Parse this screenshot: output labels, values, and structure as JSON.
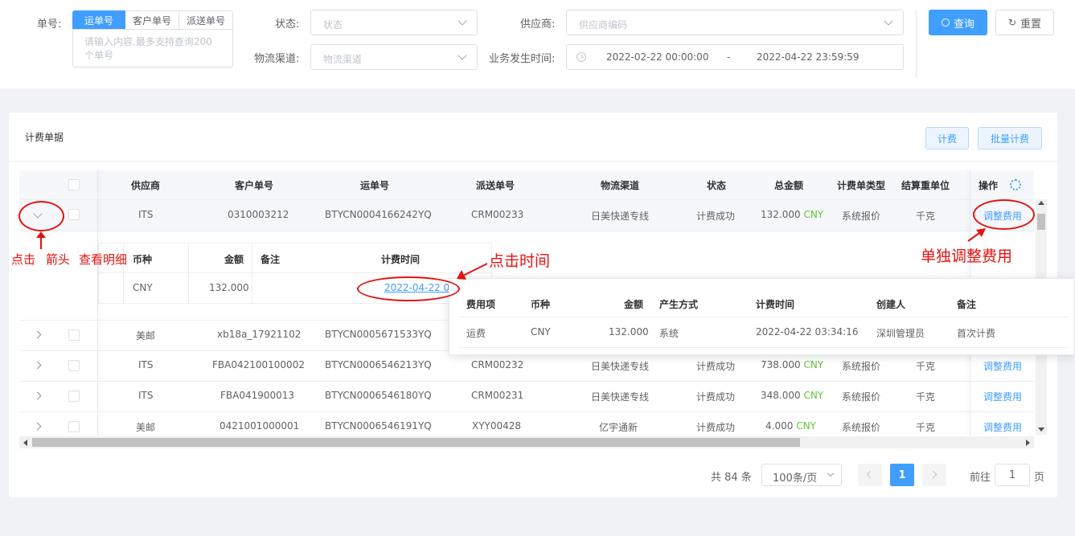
{
  "filters": {
    "order_no_label": "单号:",
    "order_tabs": [
      "运单号",
      "客户单号",
      "派送单号"
    ],
    "order_textarea_placeholder": "请输入内容,最多支持查询200个单号",
    "status_label": "状态:",
    "status_placeholder": "状态",
    "supplier_label": "供应商:",
    "supplier_placeholder": "供应商编码",
    "channel_label": "物流渠道:",
    "channel_placeholder": "物流渠道",
    "date_label": "业务发生时间:",
    "date_start": "2022-02-22 00:00:00",
    "date_sep": "-",
    "date_end": "2022-04-22 23:59:59",
    "query_button": "查询",
    "reset_button": "重置"
  },
  "panel": {
    "title": "计费单据",
    "billing_button": "计费",
    "batch_billing_button": "批量计费"
  },
  "table": {
    "headers": [
      "供应商",
      "客户单号",
      "运单号",
      "派送单号",
      "物流渠道",
      "状态",
      "总金额",
      "计费单类型",
      "结算重单位",
      "操作"
    ],
    "rows": [
      {
        "supplier": "ITS",
        "customer_no": "0310003212",
        "waybill": "BTYCN0004166242YQ",
        "delivery_no": "CRM00233",
        "channel": "日美快递专线",
        "status": "计费成功",
        "amount": "132.000",
        "currency": "CNY",
        "bill_type": "系统报价",
        "unit": "千克",
        "action": "调整费用"
      },
      {
        "supplier": "美邮",
        "customer_no": "xb18a_17921102",
        "waybill": "BTYCN0005671533YQ",
        "delivery_no": "",
        "channel": "",
        "status": "",
        "amount": "",
        "currency": "",
        "bill_type": "",
        "unit": "",
        "action": ""
      },
      {
        "supplier": "ITS",
        "customer_no": "FBA042100100002",
        "waybill": "BTYCN0006546213YQ",
        "delivery_no": "CRM00232",
        "channel": "日美快递专线",
        "status": "计费成功",
        "amount": "738.000",
        "currency": "CNY",
        "bill_type": "系统报价",
        "unit": "千克",
        "action": "调整费用"
      },
      {
        "supplier": "ITS",
        "customer_no": "FBA041900013",
        "waybill": "BTYCN0006546180YQ",
        "delivery_no": "CRM00231",
        "channel": "日美快递专线",
        "status": "计费成功",
        "amount": "348.000",
        "currency": "CNY",
        "bill_type": "系统报价",
        "unit": "千克",
        "action": "调整费用"
      },
      {
        "supplier": "美邮",
        "customer_no": "0421001000001",
        "waybill": "BTYCN0006546191YQ",
        "delivery_no": "XYY00428",
        "channel": "亿宇通新",
        "status": "计费成功",
        "amount": "4.000",
        "currency": "CNY",
        "bill_type": "系统报价",
        "unit": "千克",
        "action": "调整费用"
      }
    ],
    "detail": {
      "headers": [
        "币种",
        "金额",
        "备注",
        "计费时间"
      ],
      "row": {
        "currency": "CNY",
        "amount": "132.000",
        "remark": "",
        "time": "2022-04-22 03"
      }
    }
  },
  "popover": {
    "headers": [
      "费用项",
      "币种",
      "金额",
      "产生方式",
      "计费时间",
      "创建人",
      "备注"
    ],
    "row": {
      "fee_item": "运费",
      "currency": "CNY",
      "amount": "132.000",
      "method": "系统",
      "time": "2022-04-22 03:34:16",
      "creator": "深圳管理员",
      "remark": "首次计费"
    }
  },
  "pagination": {
    "total": "共 84 条",
    "page_size": "100条/页",
    "current_page": "1",
    "goto_label": "前往",
    "goto_value": "1",
    "page_unit": "页"
  },
  "annotations": {
    "click": "点击",
    "arrow": "箭头",
    "view_detail": "查看明细",
    "click_time": "点击时间",
    "adjust_fee": "单独调整费用"
  },
  "colors": {
    "primary": "#409eff",
    "success": "#67c23a",
    "annotation": "#e4120f"
  }
}
